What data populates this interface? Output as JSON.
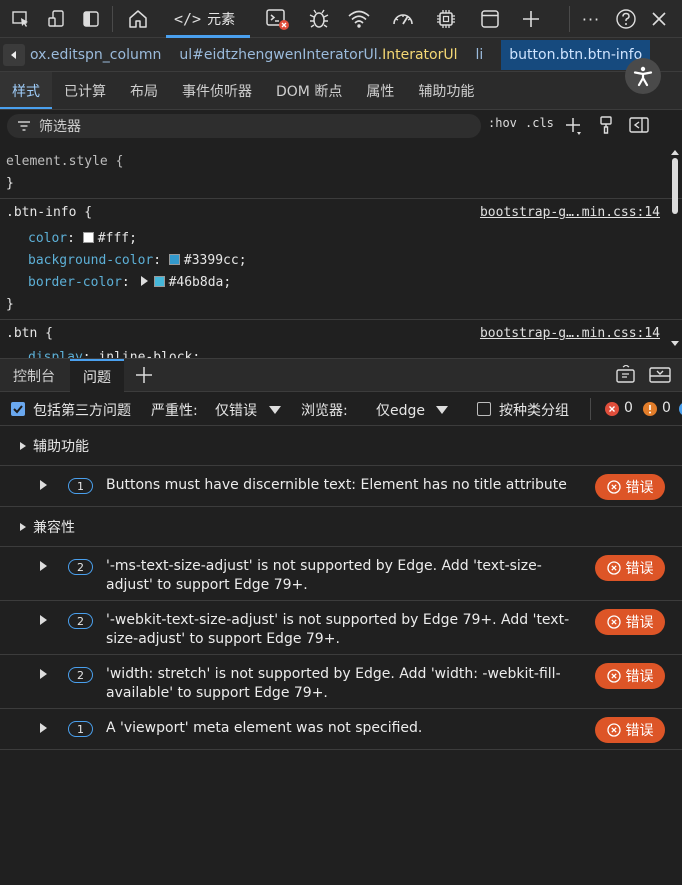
{
  "toolbar": {
    "icons": [
      "inspect-icon",
      "device-emulation-icon",
      "dock-side-icon",
      "welcome-home-icon",
      "elements-icon",
      "console-error-icon",
      "sources-bug-icon",
      "network-wifi-icon",
      "performance-gauge-icon",
      "memory-chip-icon",
      "application-window-icon",
      "more-tools-plus-icon",
      "more-options-icon",
      "help-icon",
      "close-icon"
    ],
    "elements_tab_label": "元素",
    "elements_tab_code": "</>",
    "close_glyph": "✕",
    "more_glyph": "···"
  },
  "breadcrumb": {
    "items": [
      {
        "tag": "ox.editspn_column",
        "cls": ""
      },
      {
        "tag": "ul#eidtzhengwenInteratorUl.",
        "cls": "InteratorUl"
      },
      {
        "tag": "li",
        "cls": ""
      },
      {
        "tag": "button.btn.btn-info",
        "cls": ""
      }
    ]
  },
  "subtabs": [
    "样式",
    "已计算",
    "布局",
    "事件侦听器",
    "DOM 断点",
    "属性",
    "辅助功能"
  ],
  "filter": {
    "placeholder": "筛选器",
    "hov": ":hov",
    "cls": ".cls"
  },
  "styles": {
    "element_style": {
      "selector": "element.style {",
      "close": "}"
    },
    "btn_info": {
      "selector": ".btn-info {",
      "source": "bootstrap-g….min.css:14",
      "props": [
        {
          "name": "color",
          "value": "#fff",
          "swatch": "#ffffff"
        },
        {
          "name": "background-color",
          "value": "#3399cc",
          "swatch": "#3399cc"
        },
        {
          "name": "border-color",
          "value": "#46b8da",
          "swatch": "#46b8da"
        }
      ],
      "close": "}"
    },
    "btn": {
      "selector": ".btn {",
      "source": "bootstrap-g….min.css:14",
      "props": [
        {
          "name": "display",
          "value": "inline-block"
        }
      ]
    }
  },
  "drawer": {
    "tabs": [
      "控制台",
      "问题"
    ],
    "selected": "问题"
  },
  "issues_bar": {
    "third_party_label": "包括第三方问题",
    "severity_label": "严重性:",
    "severity_value": "仅错误",
    "browser_label": "浏览器:",
    "browser_value": "仅edge",
    "group_label": "按种类分组",
    "error_count": "0",
    "warning_count": "0"
  },
  "categories": [
    {
      "label": "辅助功能"
    },
    {
      "label": "兼容性"
    }
  ],
  "issues": [
    {
      "count": "1",
      "text": "Buttons must have discernible text: Element has no title attribute",
      "severity": "错误"
    },
    {
      "count": "2",
      "text": "'-ms-text-size-adjust' is not supported by Edge. Add 'text-size-adjust' to support Edge 79+.",
      "severity": "错误"
    },
    {
      "count": "2",
      "text": "'-webkit-text-size-adjust' is not supported by Edge 79+. Add 'text-size-adjust' to support Edge 79+.",
      "severity": "错误"
    },
    {
      "count": "2",
      "text": "'width: stretch' is not supported by Edge. Add 'width: -webkit-fill-available' to support Edge 79+.",
      "severity": "错误"
    },
    {
      "count": "1",
      "text": "A 'viewport' meta element was not specified.",
      "severity": "错误"
    }
  ],
  "colors": {
    "accent": "#4aa0ee",
    "error_badge": "#dd5527",
    "prop_name": "#5db0d7"
  }
}
